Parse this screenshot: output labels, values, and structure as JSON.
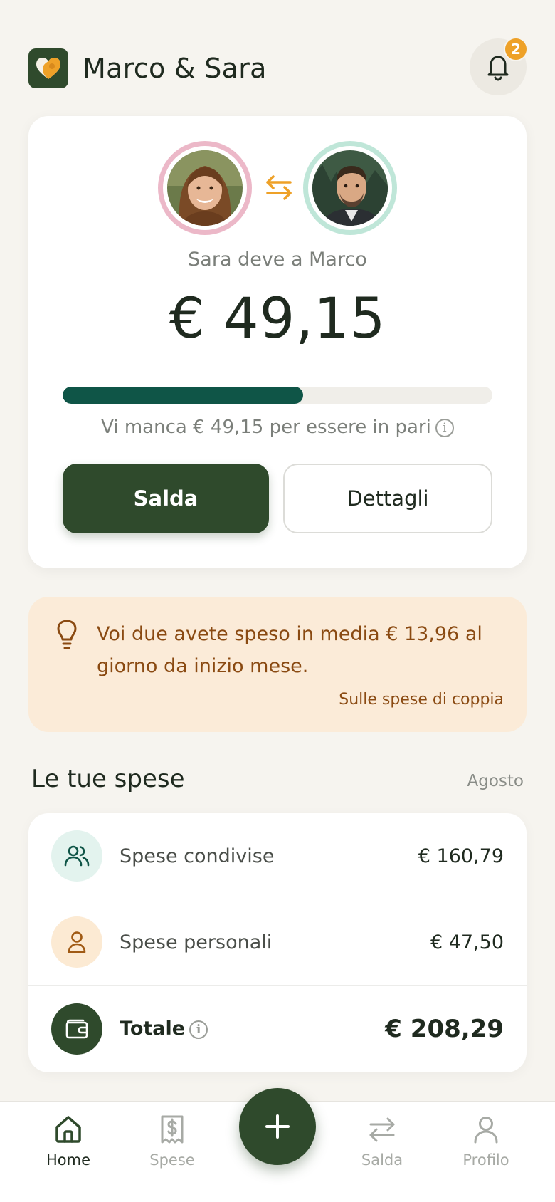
{
  "header": {
    "title": "Marco & Sara",
    "notification_count": "2",
    "logo_icon": "heart-logo-icon",
    "bell_icon": "bell-icon"
  },
  "balance": {
    "debtor_avatar": "sara-avatar",
    "creditor_avatar": "marco-avatar",
    "subtitle": "Sara deve a Marco",
    "amount": "€ 49,15",
    "progress_percent": 56,
    "caption": "Vi manca € 49,15 per essere in pari",
    "primary_button": "Salda",
    "secondary_button": "Dettagli"
  },
  "tip": {
    "icon": "lightbulb-icon",
    "text": "Voi due avete speso in media € 13,96 al giorno da inizio mese.",
    "link": "Sulle spese di coppia"
  },
  "expenses": {
    "title": "Le tue spese",
    "month": "Agosto",
    "rows": [
      {
        "label": "Spese condivise",
        "value": "€ 160,79",
        "icon": "users-icon"
      },
      {
        "label": "Spese personali",
        "value": "€ 47,50",
        "icon": "user-icon"
      },
      {
        "label": "Totale",
        "value": "€ 208,29",
        "icon": "wallet-icon"
      }
    ]
  },
  "nav": {
    "items": [
      {
        "label": "Home",
        "icon": "home-icon",
        "active": true
      },
      {
        "label": "Spese",
        "icon": "receipt-icon",
        "active": false
      },
      {
        "label": "Salda",
        "icon": "swap-icon",
        "active": false
      },
      {
        "label": "Profilo",
        "icon": "profile-icon",
        "active": false
      }
    ],
    "fab_icon": "plus-icon"
  },
  "colors": {
    "primary": "#2f4a2c",
    "progress": "#0f5547",
    "accent": "#eea128",
    "tip_background": "#fbebd8",
    "tip_text": "#8a4a12",
    "sara_ring": "#ecb8c8",
    "marco_ring": "#bfe6d8"
  }
}
